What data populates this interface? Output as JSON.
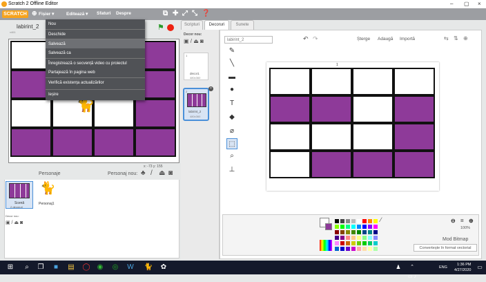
{
  "window": {
    "title": "Scratch 2 Offline Editor",
    "minimize": "–",
    "maximize": "▢",
    "close": "×"
  },
  "menubar": {
    "logo": "SCRATCH",
    "file": "Fișier ▾",
    "edit": "Editează ▾",
    "tips": "Sfaturi",
    "about": "Despre"
  },
  "file_menu": {
    "items": [
      "Nou",
      "Deschide",
      "Salvează",
      "Salvează ca",
      "Înregistrează o secvență video cu proiectul",
      "Partajează în pagina web",
      "Verifică existența actualizărilor",
      "Ieșire"
    ],
    "highlighted_index": 2
  },
  "stage": {
    "project_name": "labirint_2",
    "version": "v461",
    "coords": "x: -73   y: 155",
    "grid_pattern": [
      [
        0,
        0,
        0,
        1
      ],
      [
        1,
        1,
        1,
        1
      ],
      [
        0,
        0,
        0,
        1
      ],
      [
        1,
        1,
        1,
        1
      ]
    ]
  },
  "sprites": {
    "header": "Personaje",
    "new_sprite_label": "Personaj nou:",
    "stage_thumb_label": "Scenă",
    "stage_thumb_sub": "2 decoruri",
    "sprite_name": "Personaj1",
    "new_backdrop_label": "Decor nou:"
  },
  "tabs": [
    "Scripturi",
    "Decoruri",
    "Sunete"
  ],
  "active_tab": 1,
  "costumes": {
    "new_label": "Decor nou:",
    "items": [
      {
        "index": "1",
        "name": "decor1",
        "size": "480x360"
      },
      {
        "index": "2",
        "name": "labirint_2",
        "size": "480x360"
      }
    ]
  },
  "editor": {
    "costume_name": "labirint_2",
    "clear": "Șterge",
    "add": "Adaugă",
    "import": "Importă",
    "zoom": "100%",
    "mode": "Mod Bitmap",
    "convert": "Convertește în format vectorial",
    "canvas_pattern": [
      [
        0,
        0,
        0,
        0
      ],
      [
        1,
        1,
        0,
        1
      ],
      [
        0,
        0,
        0,
        1
      ],
      [
        0,
        1,
        1,
        1
      ]
    ],
    "marker": "1"
  },
  "colors": {
    "purple": "#8e3a99",
    "menubar": "#9c9ea2",
    "menu_bg": "#505256",
    "logo": "#f6a31c",
    "taskbar": "#14192b"
  },
  "taskbar": {
    "lang": "ENG",
    "time": "1:36 PM",
    "date": "4/27/2020"
  }
}
